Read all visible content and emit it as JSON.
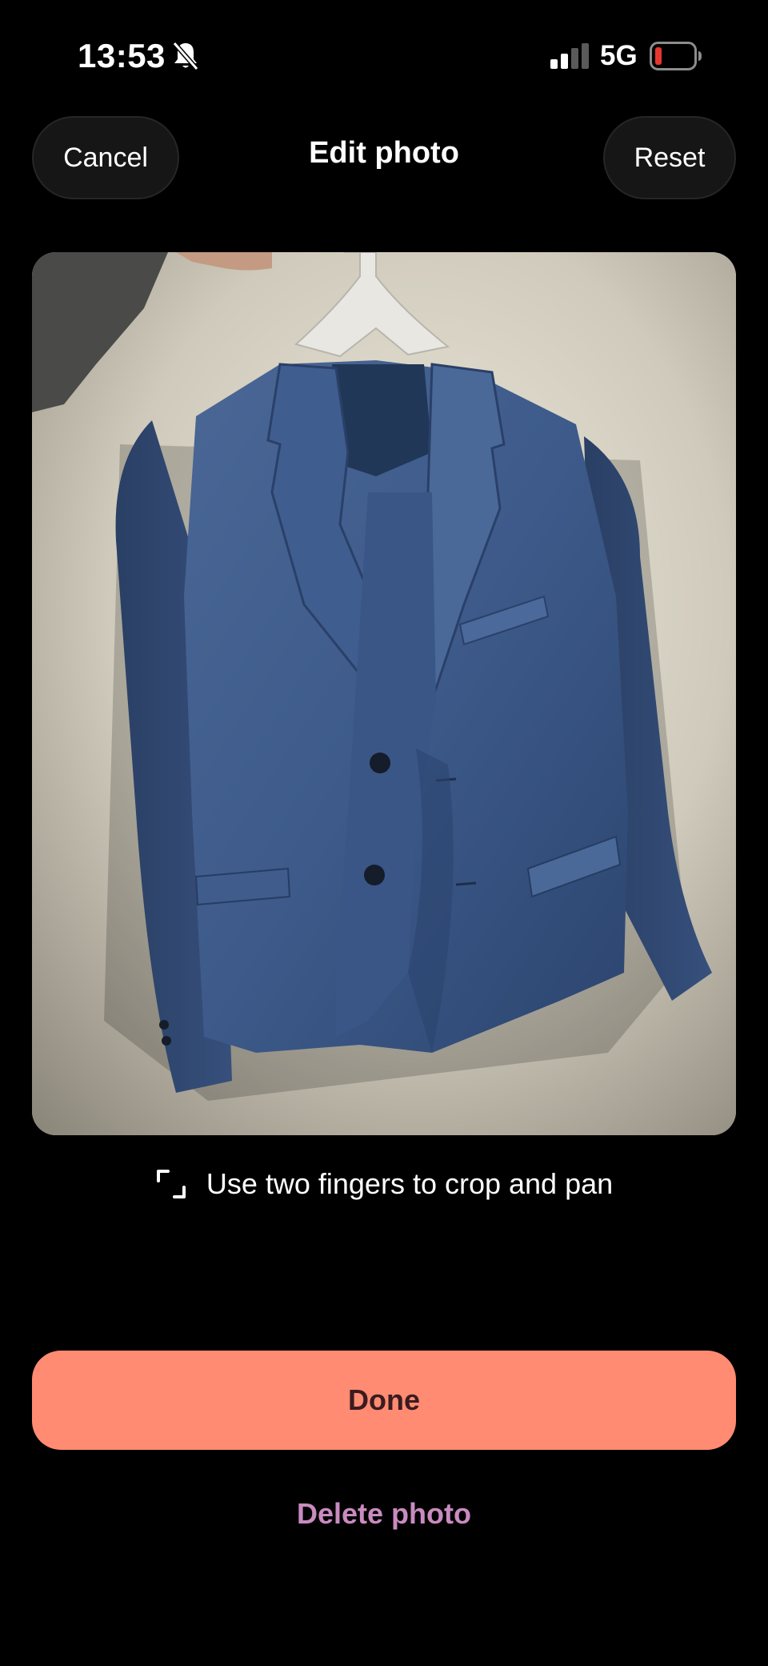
{
  "status_bar": {
    "time": "13:53",
    "network": "5G",
    "icons": [
      "bell-slash-icon",
      "signal-icon",
      "battery-low-icon"
    ]
  },
  "header": {
    "cancel_label": "Cancel",
    "title": "Edit photo",
    "reset_label": "Reset"
  },
  "photo": {
    "subject": "blue suit jacket on hanger"
  },
  "hint": {
    "icon": "crop-icon",
    "text": "Use two fingers to crop and pan"
  },
  "actions": {
    "done_label": "Done",
    "delete_label": "Delete photo"
  },
  "colors": {
    "background": "#000000",
    "done_button": "#ff8b72",
    "done_text": "#3a1b1f",
    "delete_text": "#c98bc0",
    "battery_low": "#e5372f",
    "pill_background": "#161616"
  }
}
